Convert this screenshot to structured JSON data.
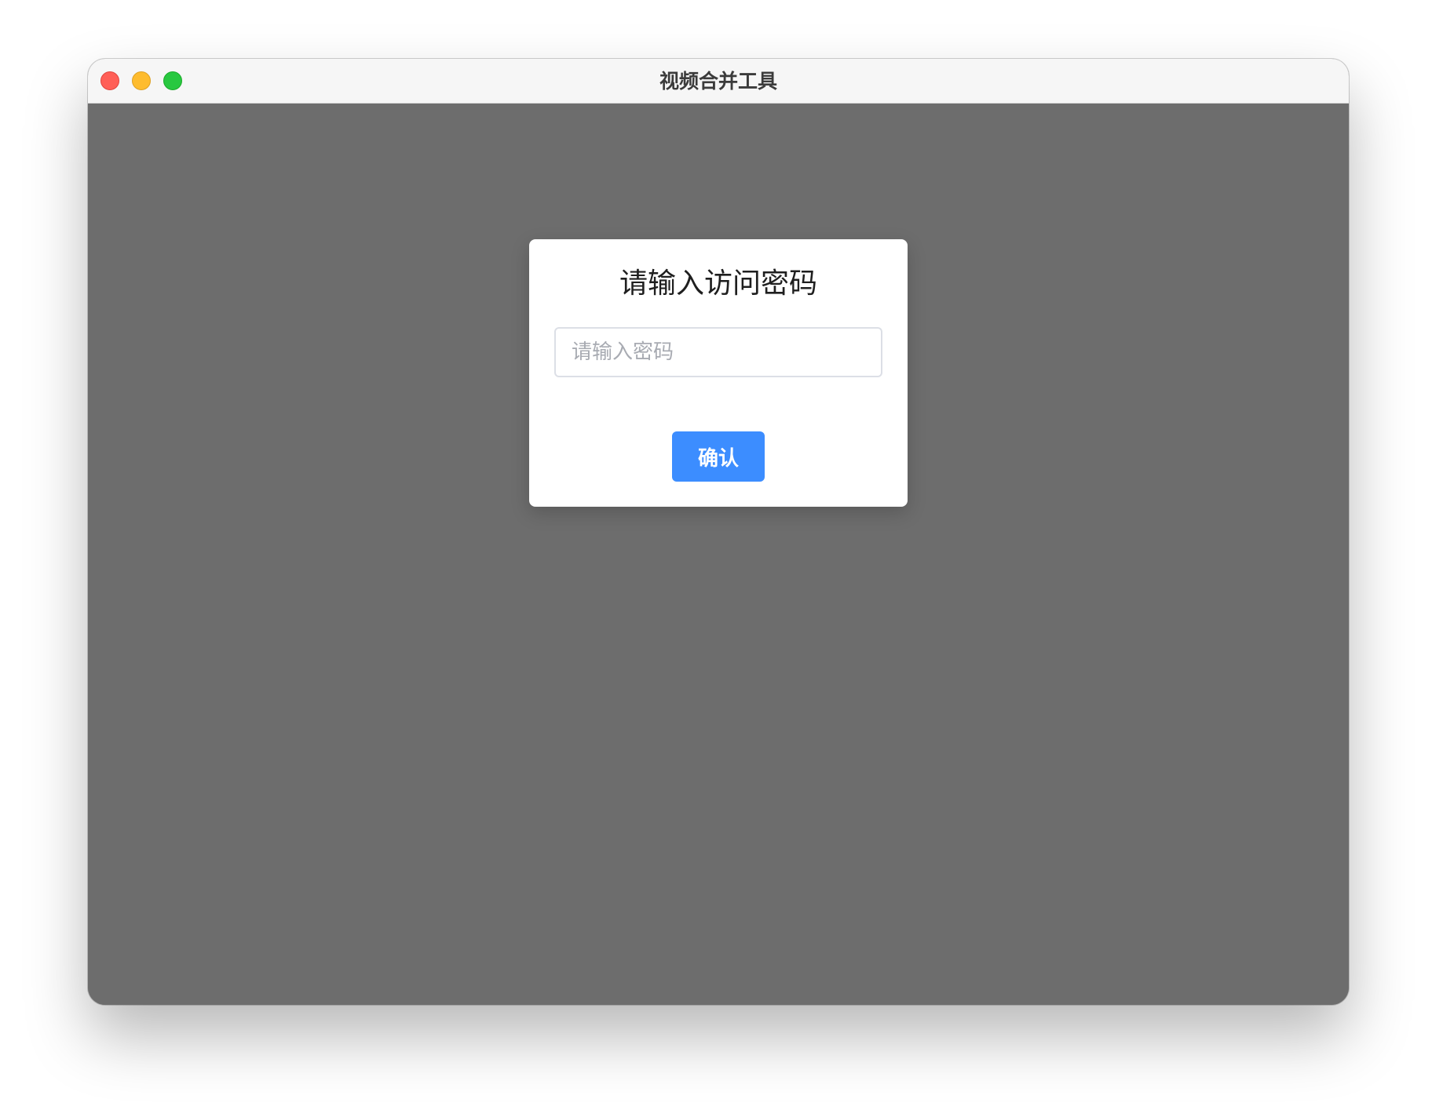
{
  "window": {
    "title": "视频合并工具"
  },
  "dialog": {
    "title": "请输入访问密码",
    "password_input": {
      "placeholder": "请输入密码",
      "value": ""
    },
    "confirm_label": "确认"
  },
  "colors": {
    "overlay": "#6d6d6d",
    "primary_button": "#3c8dff",
    "traffic_close": "#ff5f57",
    "traffic_minimize": "#febc2e",
    "traffic_zoom": "#28c840"
  }
}
